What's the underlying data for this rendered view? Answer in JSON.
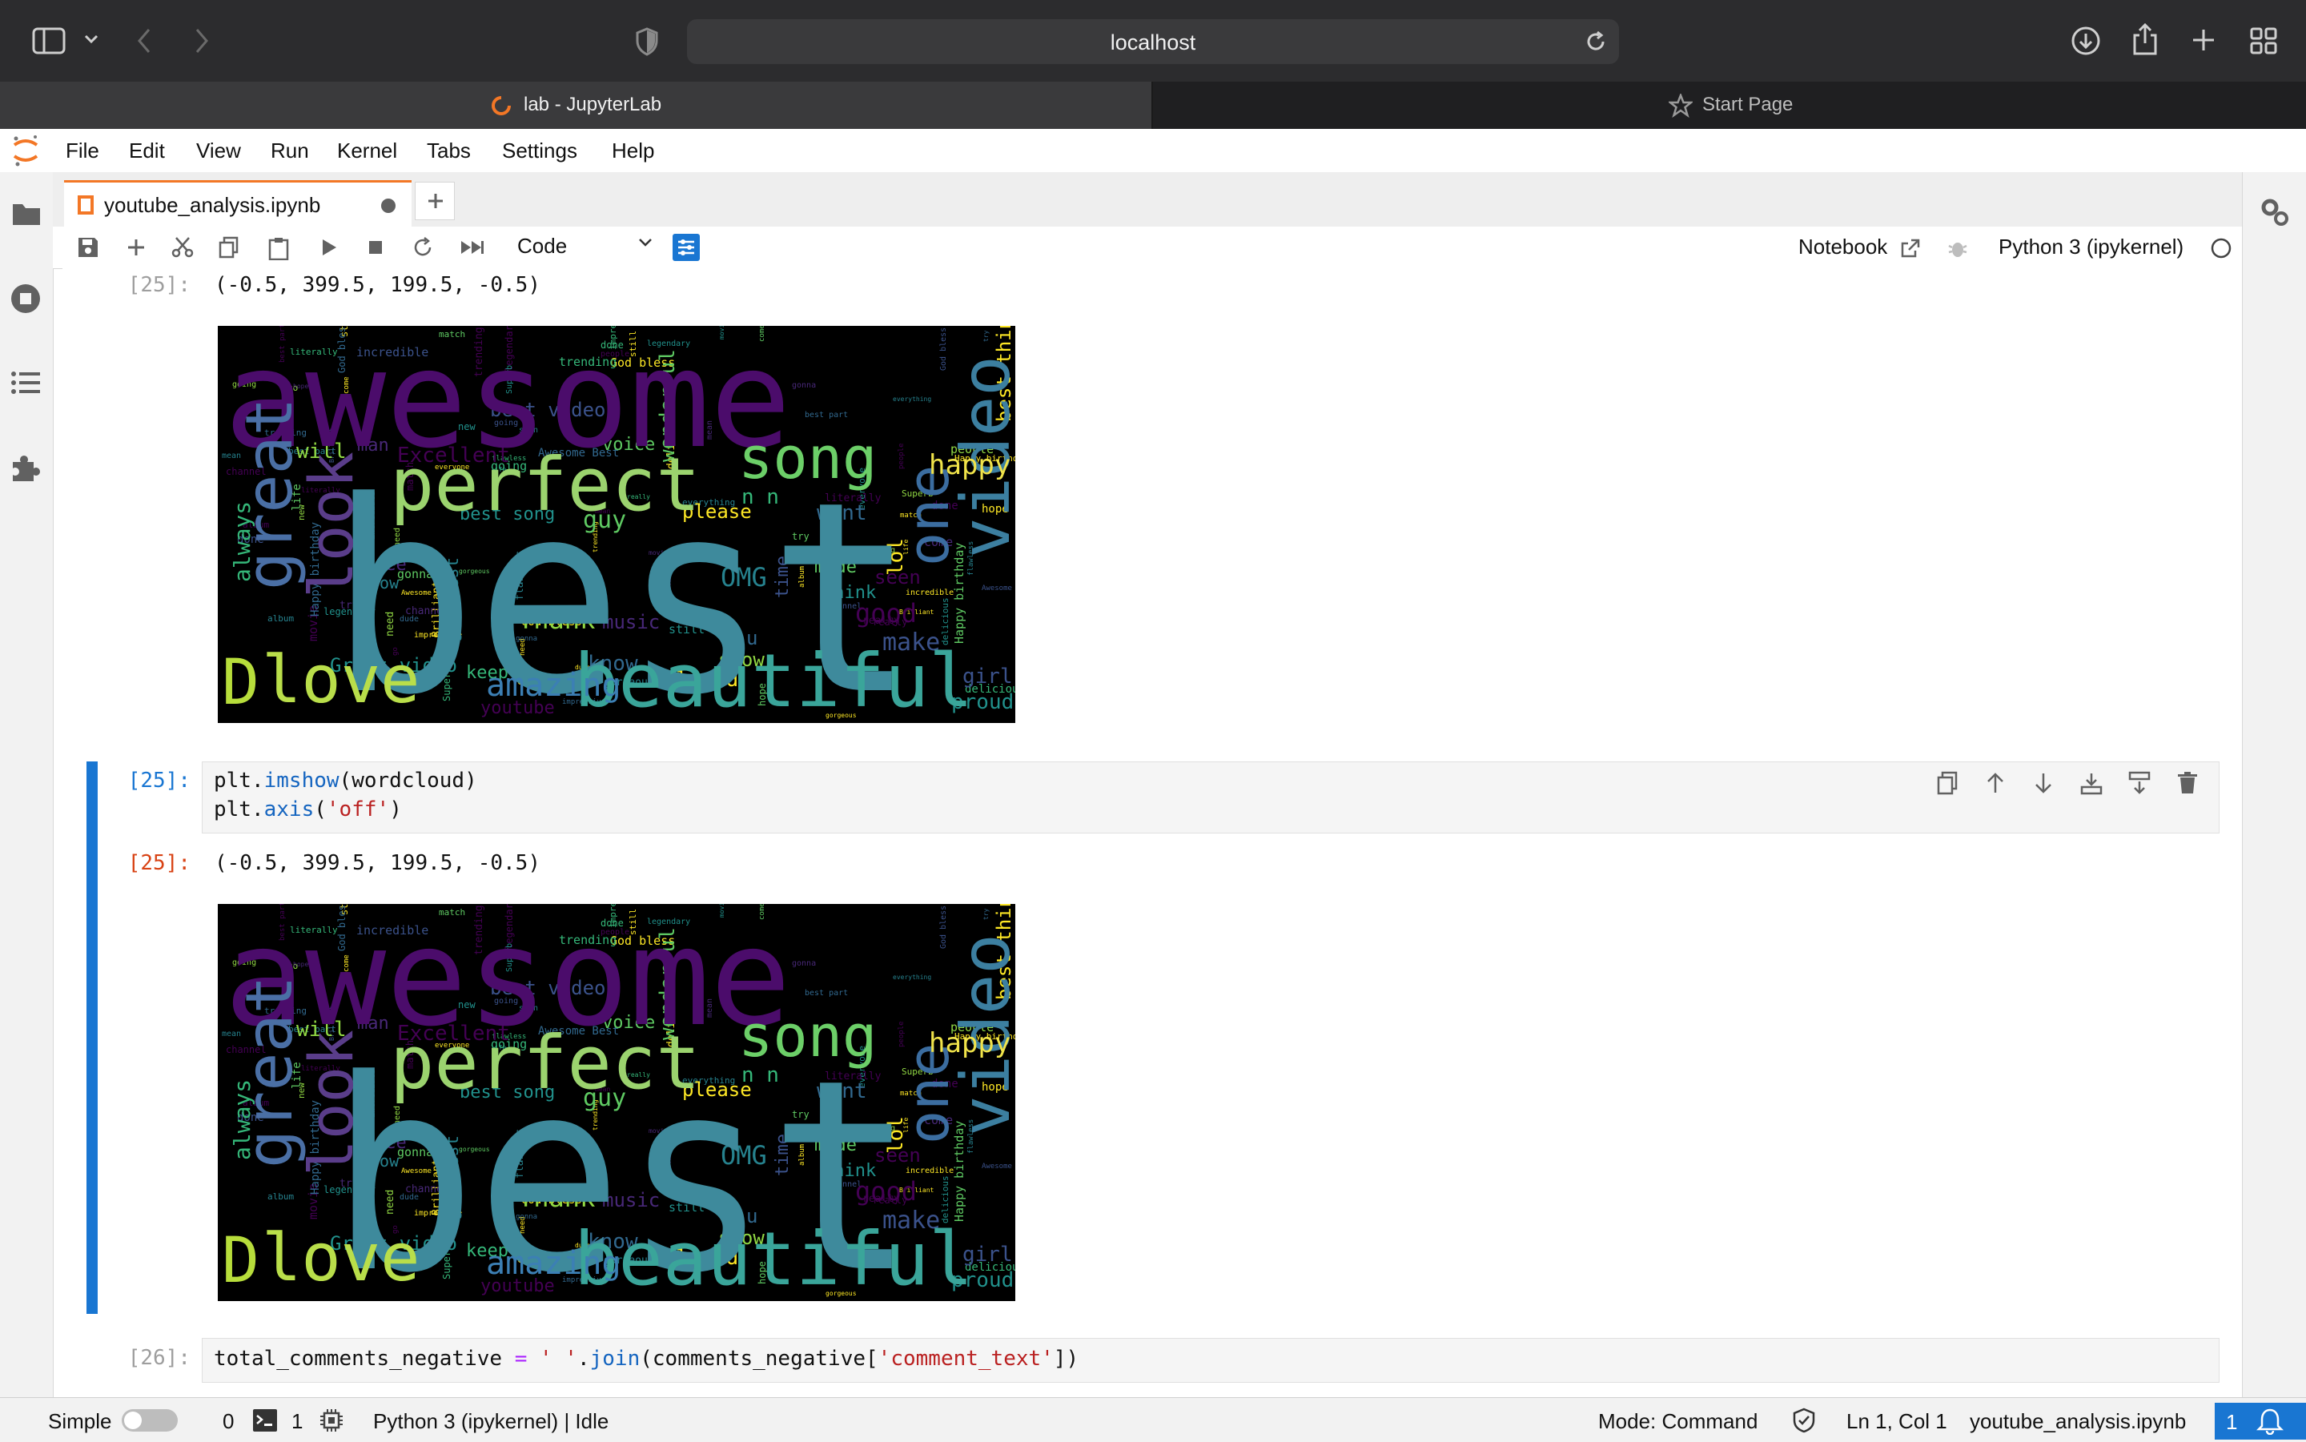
{
  "browser": {
    "url": "localhost",
    "tabs": [
      {
        "title": "lab - JupyterLab"
      },
      {
        "title": "Start Page"
      }
    ]
  },
  "menu": [
    "File",
    "Edit",
    "View",
    "Run",
    "Kernel",
    "Tabs",
    "Settings",
    "Help"
  ],
  "document_tab": {
    "filename": "youtube_analysis.ipynb"
  },
  "toolbar": {
    "cell_type": "Code",
    "notebook_label": "Notebook",
    "kernel": "Python 3 (ipykernel)"
  },
  "cells": {
    "out_prev": {
      "prompt": "[25]:",
      "text": "(-0.5, 399.5, 199.5, -0.5)"
    },
    "code_25": {
      "prompt": "[25]:",
      "lines": [
        "plt.imshow(wordcloud)",
        "plt.axis('off')"
      ]
    },
    "out_25": {
      "prompt": "[25]:",
      "text": "(-0.5, 399.5, 199.5, -0.5)"
    },
    "code_26": {
      "prompt": "[26]:",
      "line": "total_comments_negative = ' '.join(comments_negative['comment_text'])"
    }
  },
  "wordcloud": {
    "big": [
      "awesome",
      "best",
      "perfect",
      "song",
      "beautiful",
      "love",
      "D",
      "video",
      "great",
      "look",
      "one",
      "happy",
      "amazing"
    ],
    "medium": [
      "Excellent",
      "best video",
      "best song",
      "guy",
      "please",
      "want",
      "always",
      "Thank",
      "music",
      "OMG",
      "good",
      "make",
      "think",
      "made",
      "loved",
      "know",
      "keep",
      "show",
      "see",
      "now",
      "youtube",
      "girl",
      "proud",
      "wonderful",
      "lol",
      "u",
      "n n",
      "will",
      "man",
      "greatest",
      "seen",
      "time",
      "Great video",
      "voice",
      "best thing"
    ],
    "small": [
      "trending",
      "God bless",
      "Brilliant",
      "Awesome Best",
      "incredible",
      "impressive",
      "dude",
      "need",
      "life",
      "match",
      "album",
      "literally",
      "Happy birthday",
      "everyone",
      "gonna",
      "delicious",
      "legendary",
      "flawless",
      "channel",
      "hope",
      "movie",
      "try",
      "go",
      "done",
      "people",
      "going",
      "still",
      "new",
      "skin",
      "mean",
      "best part",
      "everything",
      "really",
      "gorgeous",
      "Superb",
      "come"
    ]
  },
  "status": {
    "mode_label": "Simple",
    "terminals": "0",
    "kernels": "1",
    "kernel_status": "Python 3 (ipykernel) | Idle",
    "command_mode": "Mode: Command",
    "cursor": "Ln 1, Col 1",
    "filename": "youtube_analysis.ipynb",
    "notifications": "1"
  }
}
